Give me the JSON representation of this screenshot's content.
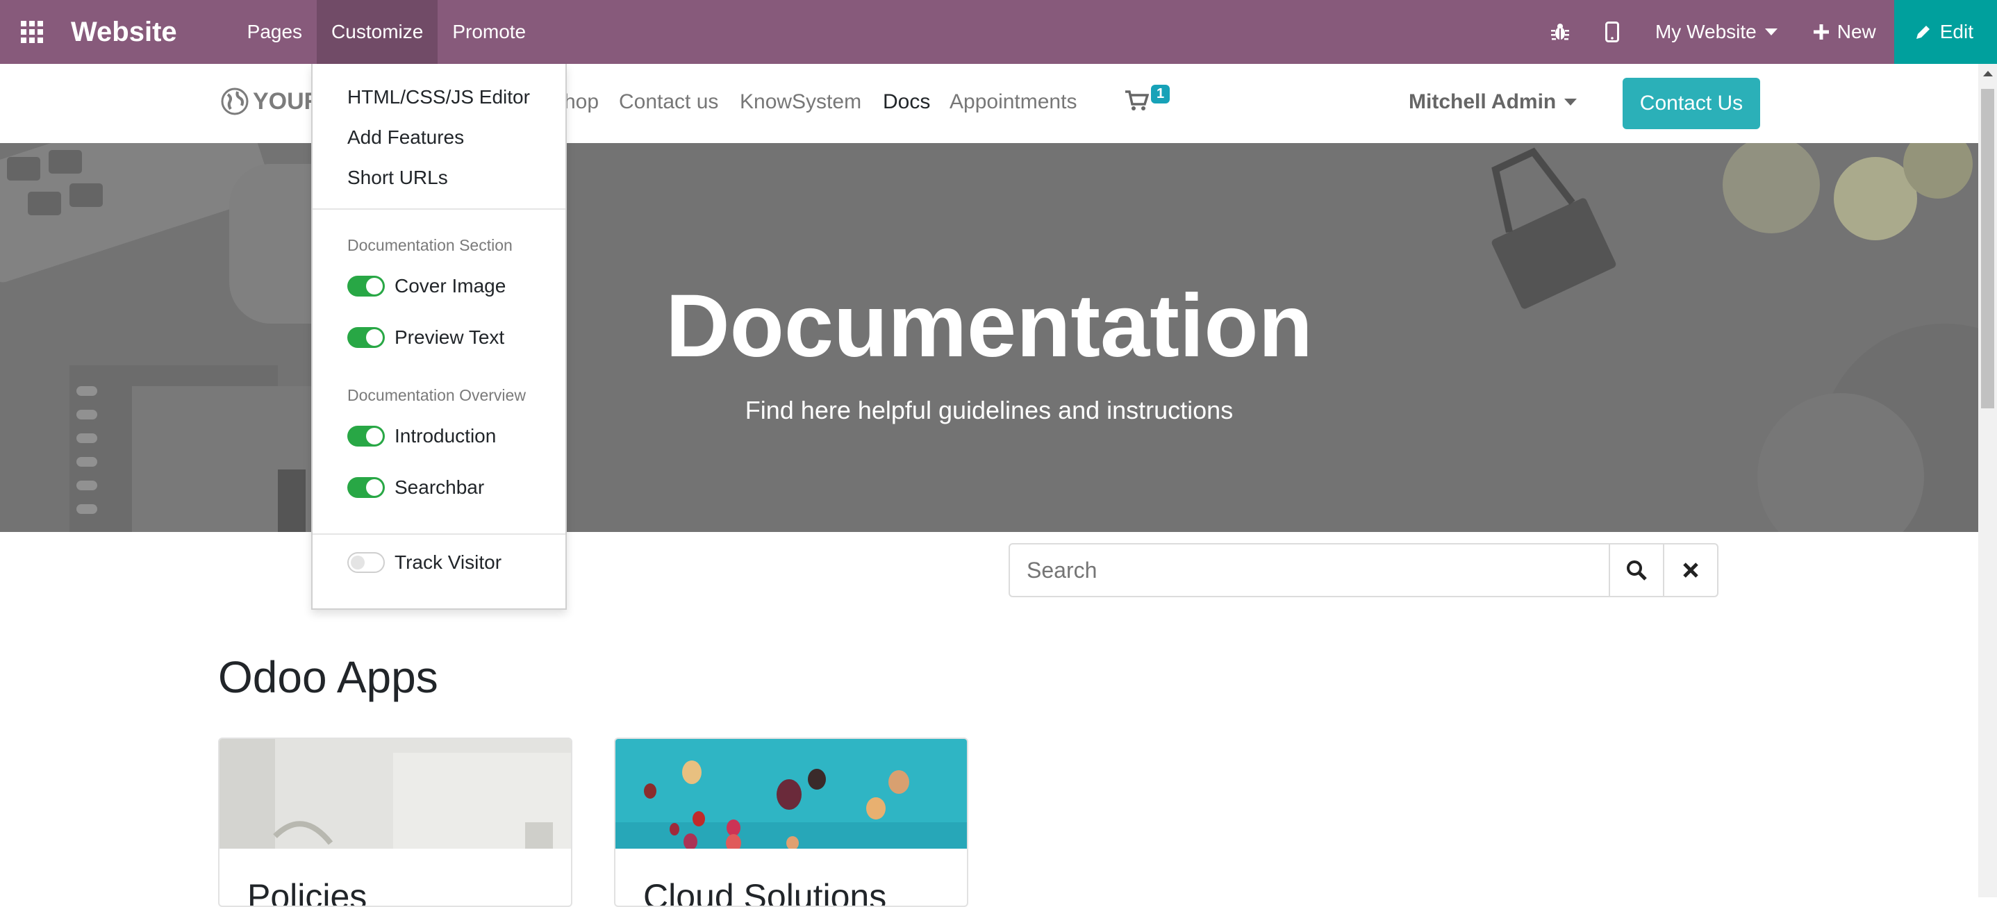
{
  "topbar": {
    "brand": "Website",
    "menu": [
      "Pages",
      "Customize",
      "Promote"
    ],
    "active_menu": "Customize",
    "website_selector": "My Website",
    "new_label": "New",
    "edit_label": "Edit",
    "colors": {
      "bar": "#875a7b",
      "edit": "#00a09d"
    }
  },
  "site_header": {
    "logo_text": "YOUR",
    "nav": [
      "hop",
      "Contact us",
      "KnowSystem",
      "Docs",
      "Appointments"
    ],
    "active_nav": "Docs",
    "cart_count": "1",
    "user_name": "Mitchell Admin",
    "contact_button": "Contact Us"
  },
  "hero": {
    "title": "Documentation",
    "subtitle": "Find here helpful guidelines and instructions"
  },
  "search": {
    "placeholder": "Search"
  },
  "section": {
    "title": "Odoo Apps",
    "cards": [
      "Policies",
      "Cloud Solutions"
    ]
  },
  "customize_menu": {
    "items": [
      "HTML/CSS/JS Editor",
      "Add Features",
      "Short URLs"
    ],
    "doc_section_header": "Documentation Section",
    "doc_section_toggles": [
      {
        "label": "Cover Image",
        "on": true
      },
      {
        "label": "Preview Text",
        "on": true
      }
    ],
    "doc_overview_header": "Documentation Overview",
    "doc_overview_toggles": [
      {
        "label": "Introduction",
        "on": true
      },
      {
        "label": "Searchbar",
        "on": true
      }
    ],
    "track_visitor": {
      "label": "Track Visitor",
      "on": false
    }
  }
}
